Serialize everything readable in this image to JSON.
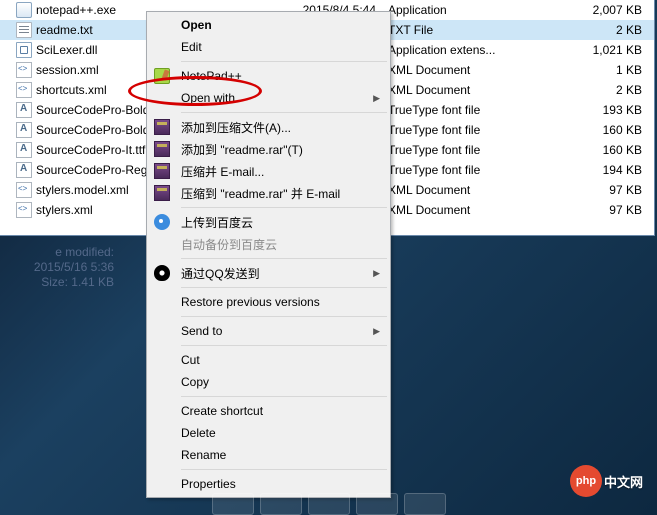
{
  "files": [
    {
      "name": "notepad++.exe",
      "date": "2015/8/4 5:44",
      "type": "Application",
      "size": "2,007 KB",
      "icon": "i-exe",
      "sel": false
    },
    {
      "name": "readme.txt",
      "date": "",
      "type": "TXT File",
      "size": "2 KB",
      "icon": "i-txt",
      "sel": true
    },
    {
      "name": "SciLexer.dll",
      "date": "",
      "type": "Application extens...",
      "size": "1,021 KB",
      "icon": "i-dll",
      "sel": false
    },
    {
      "name": "session.xml",
      "date": "",
      "type": "XML Document",
      "size": "1 KB",
      "icon": "i-xml",
      "sel": false
    },
    {
      "name": "shortcuts.xml",
      "date": "",
      "type": "XML Document",
      "size": "2 KB",
      "icon": "i-xml",
      "sel": false
    },
    {
      "name": "SourceCodePro-Bold",
      "date": "",
      "type": "TrueType font file",
      "size": "193 KB",
      "icon": "i-ttf",
      "sel": false
    },
    {
      "name": "SourceCodePro-Bold",
      "date": "",
      "type": "TrueType font file",
      "size": "160 KB",
      "icon": "i-ttf",
      "sel": false
    },
    {
      "name": "SourceCodePro-It.ttf",
      "date": "",
      "type": "TrueType font file",
      "size": "160 KB",
      "icon": "i-ttf",
      "sel": false
    },
    {
      "name": "SourceCodePro-Regu",
      "date": "",
      "type": "TrueType font file",
      "size": "194 KB",
      "icon": "i-ttf",
      "sel": false
    },
    {
      "name": "stylers.model.xml",
      "date": "",
      "type": "XML Document",
      "size": "97 KB",
      "icon": "i-xml",
      "sel": false
    },
    {
      "name": "stylers.xml",
      "date": "",
      "type": "XML Document",
      "size": "97 KB",
      "icon": "i-xml",
      "sel": false
    }
  ],
  "details": {
    "modified_label": "e modified:",
    "modified_value": "2015/5/16 5:36",
    "size_label": "Size:",
    "size_value": "1.41 KB"
  },
  "menu": [
    {
      "kind": "item",
      "label": "Open",
      "bold": true
    },
    {
      "kind": "item",
      "label": "Edit"
    },
    {
      "kind": "sep"
    },
    {
      "kind": "item",
      "label": "NotePad++",
      "icon": "i-np"
    },
    {
      "kind": "item",
      "label": "Open with",
      "submenu": true
    },
    {
      "kind": "sep"
    },
    {
      "kind": "item",
      "label": "添加到压缩文件(A)...",
      "icon": "i-rar"
    },
    {
      "kind": "item",
      "label": "添加到 \"readme.rar\"(T)",
      "icon": "i-rar"
    },
    {
      "kind": "item",
      "label": "压缩并 E-mail...",
      "icon": "i-rar"
    },
    {
      "kind": "item",
      "label": "压缩到 \"readme.rar\" 并 E-mail",
      "icon": "i-rar"
    },
    {
      "kind": "sep"
    },
    {
      "kind": "item",
      "label": "上传到百度云",
      "icon": "i-bd"
    },
    {
      "kind": "item",
      "label": "自动备份到百度云",
      "disabled": true
    },
    {
      "kind": "sep"
    },
    {
      "kind": "item",
      "label": "通过QQ发送到",
      "icon": "i-qq",
      "submenu": true
    },
    {
      "kind": "sep"
    },
    {
      "kind": "item",
      "label": "Restore previous versions"
    },
    {
      "kind": "sep"
    },
    {
      "kind": "item",
      "label": "Send to",
      "submenu": true
    },
    {
      "kind": "sep"
    },
    {
      "kind": "item",
      "label": "Cut"
    },
    {
      "kind": "item",
      "label": "Copy"
    },
    {
      "kind": "sep"
    },
    {
      "kind": "item",
      "label": "Create shortcut"
    },
    {
      "kind": "item",
      "label": "Delete"
    },
    {
      "kind": "item",
      "label": "Rename"
    },
    {
      "kind": "sep"
    },
    {
      "kind": "item",
      "label": "Properties"
    }
  ],
  "badge": {
    "logo": "php",
    "text": "中文网"
  }
}
